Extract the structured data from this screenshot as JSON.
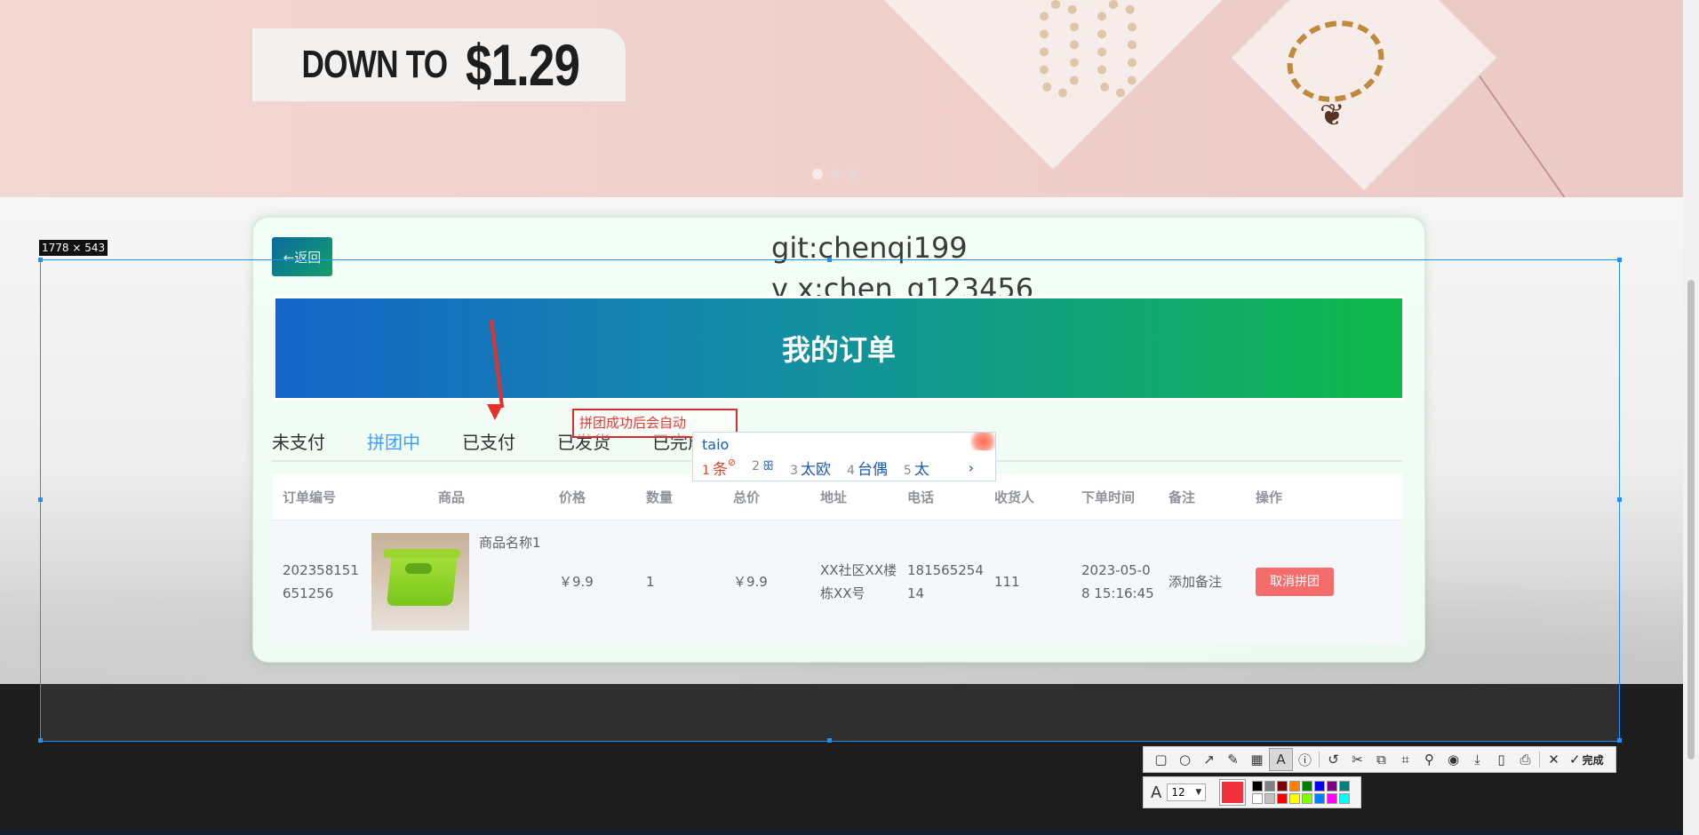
{
  "banner": {
    "promo_prefix": "DOWN TO",
    "promo_price": "$1.29"
  },
  "selection": {
    "size_label": "1778 × 543"
  },
  "watermark": {
    "line1": "git:chenqi199",
    "line2": "v x:chen_q123456"
  },
  "page": {
    "back_label": "←返回",
    "title": "我的订单"
  },
  "tabs": [
    {
      "label": "未支付"
    },
    {
      "label": "拼团中"
    },
    {
      "label": "已支付"
    },
    {
      "label": "已发货"
    },
    {
      "label": "已完成"
    }
  ],
  "table": {
    "headers": [
      "订单编号",
      "商品",
      "价格",
      "数量",
      "总价",
      "地址",
      "电话",
      "收货人",
      "下单时间",
      "备注",
      "操作"
    ],
    "rows": [
      {
        "order_id": "202358151651256",
        "product_name": "商品名称1",
        "price": "￥9.9",
        "quantity": "1",
        "total": "￥9.9",
        "address": "XX社区XX楼栋XX号",
        "phone": "18156525414",
        "receiver": "111",
        "order_time": "2023-05-08 15:16:45",
        "remark": "添加备注",
        "action": "取消拼团"
      }
    ]
  },
  "annotation": {
    "text": "拼团成功后会自动"
  },
  "ime": {
    "composition": "taio",
    "candidates": [
      {
        "num": "1",
        "text": "条"
      },
      {
        "num": "2",
        "text": "ꕥ"
      },
      {
        "num": "3",
        "text": "太欧"
      },
      {
        "num": "4",
        "text": "台偶"
      },
      {
        "num": "5",
        "text": "太"
      }
    ],
    "more": "›"
  },
  "toolbar": {
    "tools": [
      "rectangle-icon",
      "ellipse-icon",
      "arrow-icon",
      "pen-icon",
      "mosaic-icon",
      "text-icon",
      "serial-number-icon",
      "undo-icon",
      "cut-icon",
      "translate-icon",
      "ocr-icon",
      "pin-icon",
      "record-icon",
      "download-icon",
      "phone-icon",
      "save-icon",
      "close-icon"
    ],
    "done_label": "完成",
    "font_size": "12",
    "current_color": "#f0303a",
    "palette": [
      "#000000",
      "#808080",
      "#800000",
      "#ff8000",
      "#008000",
      "#0000ff",
      "#800080",
      "#008080",
      "#ffffff",
      "#c0c0c0",
      "#ff0000",
      "#ffff00",
      "#80ff00",
      "#0080ff",
      "#ff00ff",
      "#00ffff"
    ]
  }
}
